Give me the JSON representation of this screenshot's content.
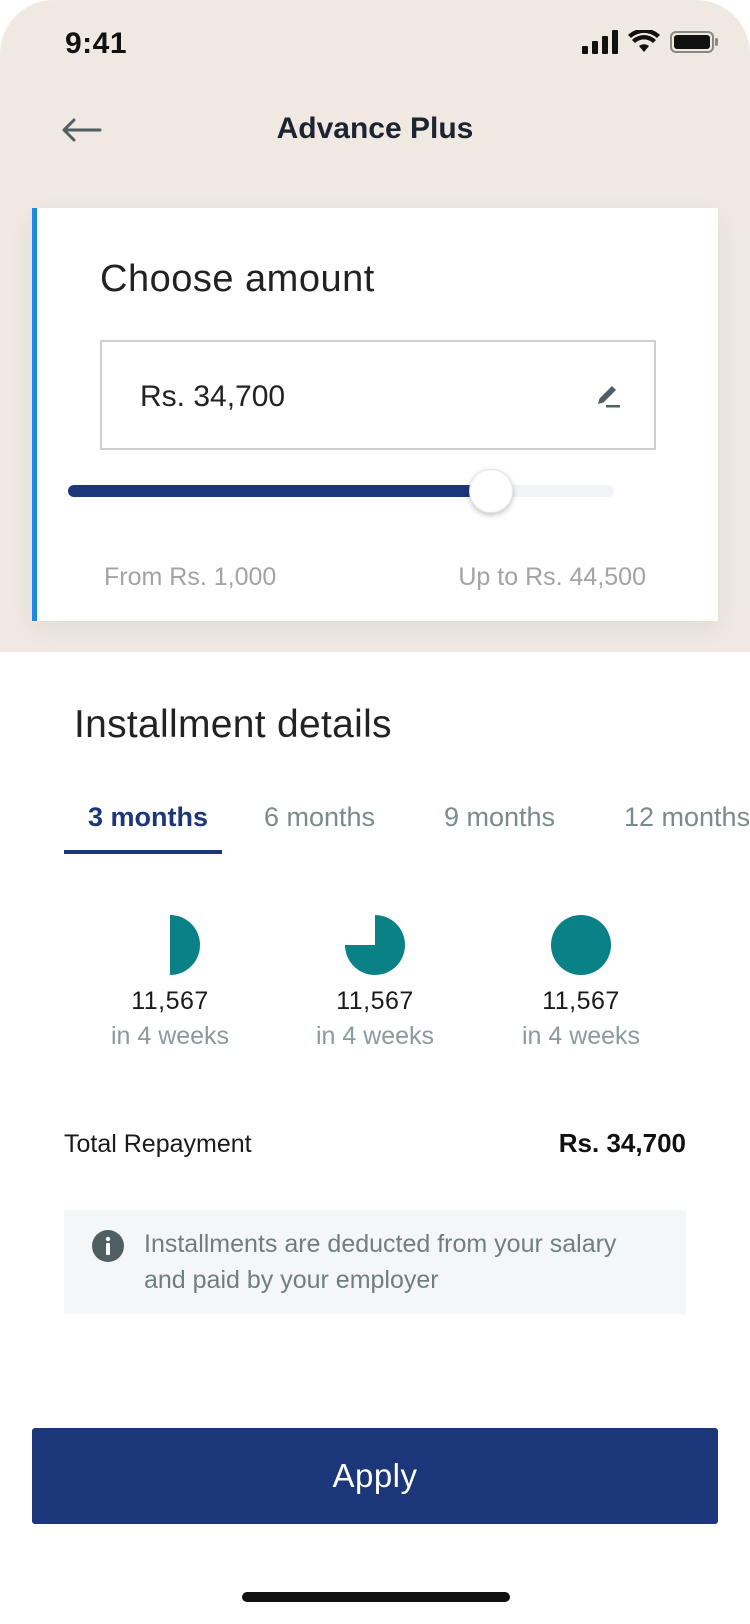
{
  "status_bar": {
    "time": "9:41",
    "icons": [
      "cellular-signal-icon",
      "wifi-icon",
      "battery-icon"
    ]
  },
  "nav": {
    "back_icon": "arrow-left-icon",
    "title": "Advance Plus"
  },
  "amount_card": {
    "title": "Choose amount",
    "amount_value": "Rs. 34,700",
    "edit_icon": "pencil-icon",
    "slider": {
      "min": 1000,
      "max": 44500,
      "value": 34700
    },
    "range_min_label": "From Rs. 1,000",
    "range_max_label": "Up to Rs. 44,500",
    "accent_color": "#1e88e5"
  },
  "installment_details": {
    "title": "Installment details",
    "tabs": [
      {
        "label": "3 months",
        "active": true
      },
      {
        "label": "6 months",
        "active": false
      },
      {
        "label": "9 months",
        "active": false
      },
      {
        "label": "12 months",
        "active": false
      }
    ],
    "installments": [
      {
        "amount": "11,567",
        "when": "in 4 weeks",
        "progress": 0.5
      },
      {
        "amount": "11,567",
        "when": "in 4 weeks",
        "progress": 0.75
      },
      {
        "amount": "11,567",
        "when": "in 4 weeks",
        "progress": 1.0
      }
    ],
    "pie_color": "#0a8087"
  },
  "total": {
    "label": "Total Repayment",
    "value": "Rs. 34,700"
  },
  "info": {
    "icon": "info-icon",
    "text": "Installments are deducted from your salary and paid by your employer"
  },
  "apply_button": {
    "label": "Apply",
    "color": "#1c367a"
  }
}
